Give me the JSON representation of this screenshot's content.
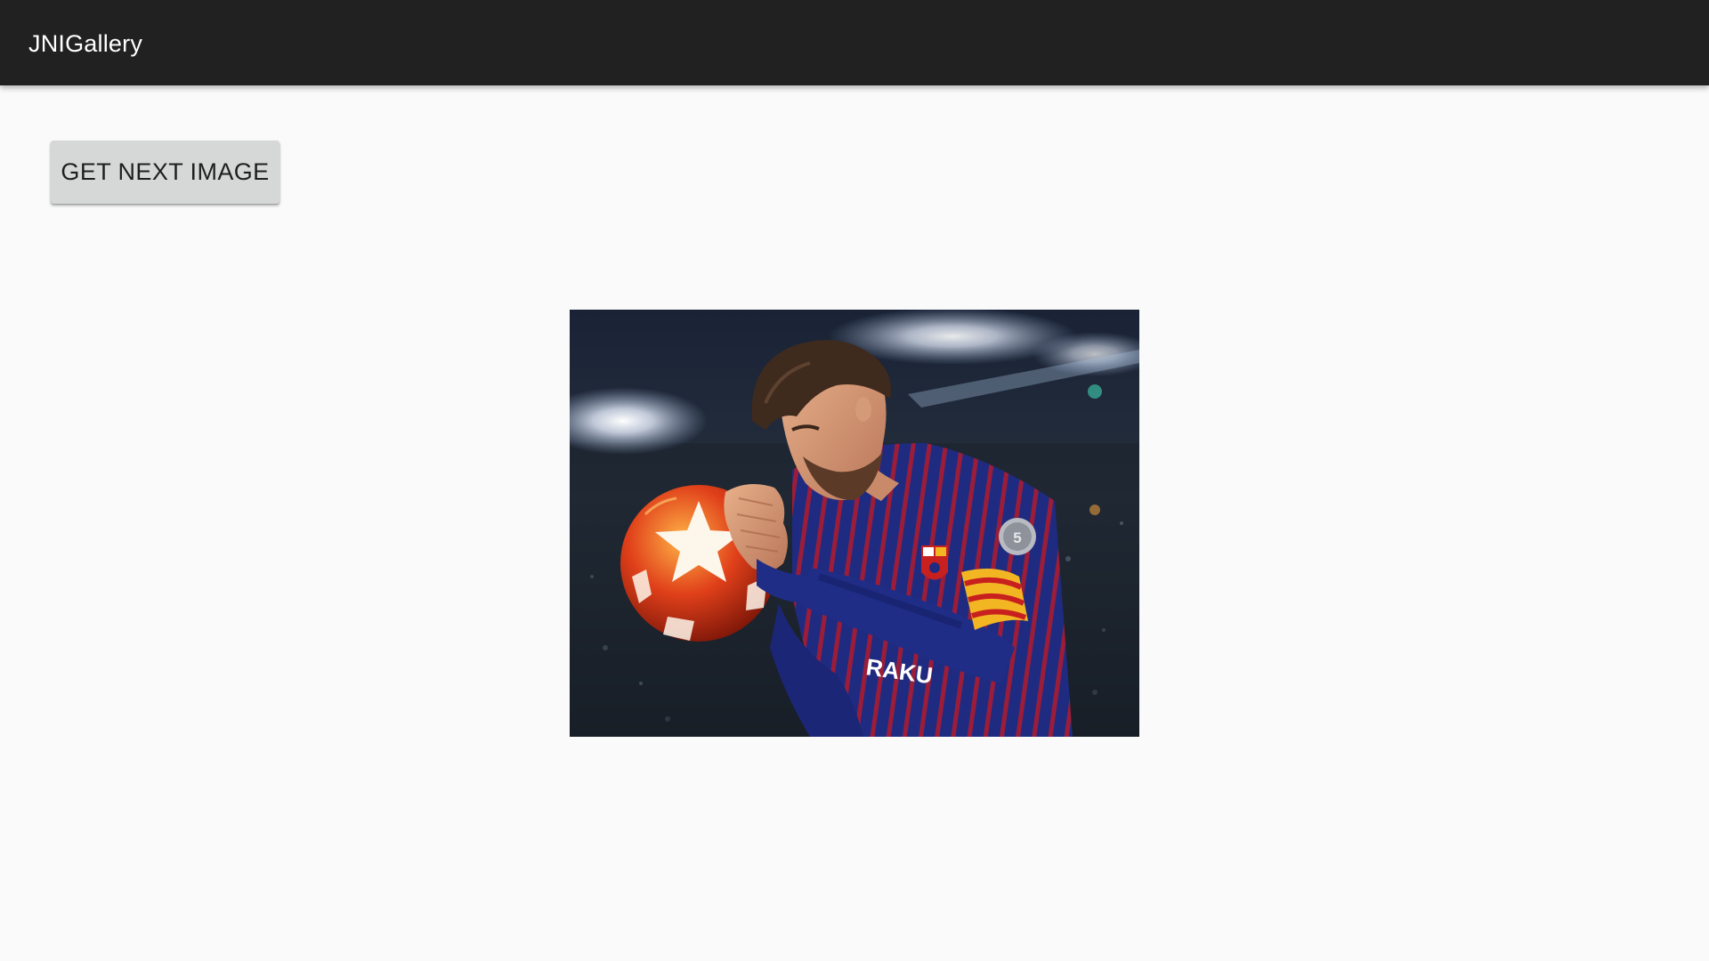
{
  "app_bar": {
    "title": "JNIGallery",
    "background_color": "#212121",
    "title_color": "#ffffff"
  },
  "controls": {
    "next_button_label": "GET NEXT IMAGE",
    "button_color": "#d6d7d7"
  },
  "gallery": {
    "current_image": "soccer-player-holding-ball-photo",
    "jersey_text": "RAKU",
    "badge_text": "5",
    "page_background": "#fafafa"
  }
}
